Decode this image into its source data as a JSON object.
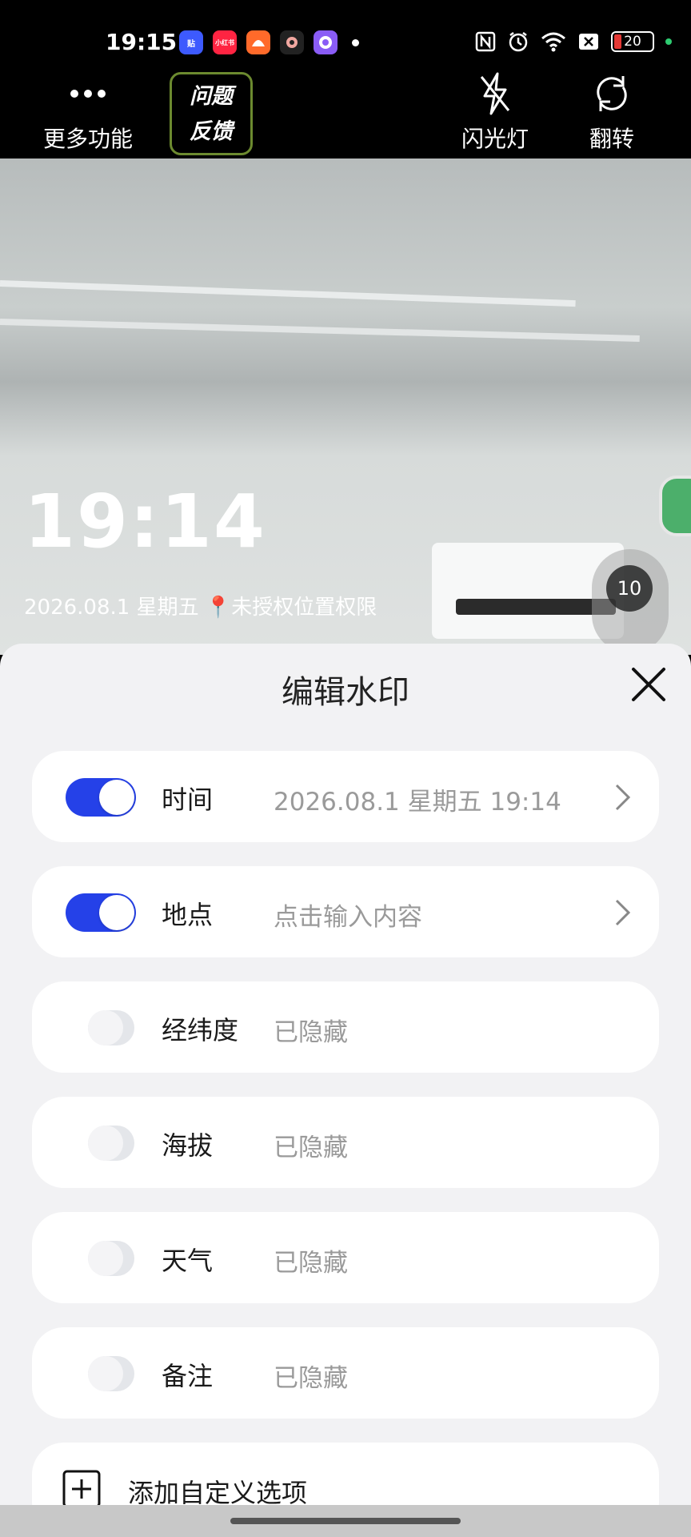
{
  "status_bar": {
    "time": "19:15",
    "apps": [
      {
        "name": "tieba-app-icon",
        "label": "贴",
        "color": "#3d5afe"
      },
      {
        "name": "xiaohongshu-app-icon",
        "label": "小红书",
        "color": "#ff2442"
      },
      {
        "name": "meituan-app-icon",
        "label": "",
        "color": "#ff6a2a"
      },
      {
        "name": "camera-app-icon",
        "label": "",
        "color": "#333333"
      },
      {
        "name": "assistant-app-icon",
        "label": "",
        "color": "#8a5cf6"
      }
    ],
    "battery": "20"
  },
  "toolbar": {
    "more_label": "更多功能",
    "feedback_line1": "问题",
    "feedback_line2": "反馈",
    "flash_label": "闪光灯",
    "flip_label": "翻转"
  },
  "preview": {
    "watermark_time": "19:14",
    "watermark_date": "2026.08.1 星期五 📍未授权位置权限",
    "zoom_level": "10"
  },
  "sheet": {
    "title": "编辑水印",
    "rows": [
      {
        "label": "时间",
        "value": "2026.08.1 星期五 19:14",
        "enabled": true,
        "has_chevron": true
      },
      {
        "label": "地点",
        "value": "点击输入内容",
        "enabled": true,
        "has_chevron": true
      },
      {
        "label": "经纬度",
        "value": "已隐藏",
        "enabled": false,
        "has_chevron": false
      },
      {
        "label": "海拔",
        "value": "已隐藏",
        "enabled": false,
        "has_chevron": false
      },
      {
        "label": "天气",
        "value": "已隐藏",
        "enabled": false,
        "has_chevron": false
      },
      {
        "label": "备注",
        "value": "已隐藏",
        "enabled": false,
        "has_chevron": false
      }
    ],
    "add_label": "添加自定义选项"
  },
  "colors": {
    "toggle_on": "#2541e8",
    "feedback_border": "#6c8a2f"
  }
}
